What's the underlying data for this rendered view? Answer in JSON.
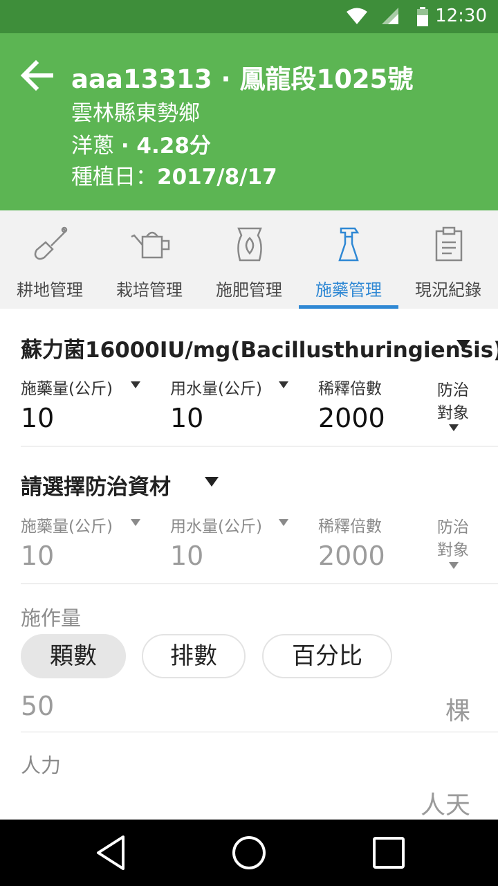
{
  "status_bar": {
    "time": "12:30",
    "icons": [
      "wifi-icon",
      "signal-icon",
      "battery-icon"
    ]
  },
  "header": {
    "title": "aaa13313 · 鳳龍段1025號",
    "location": "雲林縣東勢鄉",
    "crop": "洋蔥",
    "area": "· 4.28分",
    "planting_label": "種植日：",
    "planting_date": "2017/8/17"
  },
  "tabs": [
    {
      "label": "耕地管理",
      "icon": "shovel-icon"
    },
    {
      "label": "栽培管理",
      "icon": "watering-can-icon"
    },
    {
      "label": "施肥管理",
      "icon": "fertilizer-bag-icon"
    },
    {
      "label": "施藥管理",
      "icon": "spray-bottle-icon",
      "active": true
    },
    {
      "label": "現況紀錄",
      "icon": "clipboard-icon"
    }
  ],
  "pesticide_entries": [
    {
      "product": "蘇力菌16000IU/mg(Bacillusthuringiensis)",
      "dose_label": "施藥量(公斤)",
      "dose_value": "10",
      "water_label": "用水量(公斤)",
      "water_value": "10",
      "dilution_label": "稀釋倍數",
      "dilution_value": "2000",
      "target_label_1": "防治",
      "target_label_2": "對象"
    },
    {
      "product": "請選擇防治資材",
      "dose_label": "施藥量(公斤)",
      "dose_value": "10",
      "water_label": "用水量(公斤)",
      "water_value": "10",
      "dilution_label": "稀釋倍數",
      "dilution_value": "2000",
      "target_label_1": "防治",
      "target_label_2": "對象"
    }
  ],
  "application": {
    "label": "施作量",
    "options": [
      "顆數",
      "排數",
      "百分比"
    ],
    "selected": "顆數",
    "amount_value": "50",
    "amount_unit": "棵"
  },
  "labor": {
    "label": "人力",
    "unit": "人天"
  },
  "colors": {
    "status_bar": "#3e8e3a",
    "app_bar": "#5cb553",
    "accent": "#2f88d4"
  }
}
